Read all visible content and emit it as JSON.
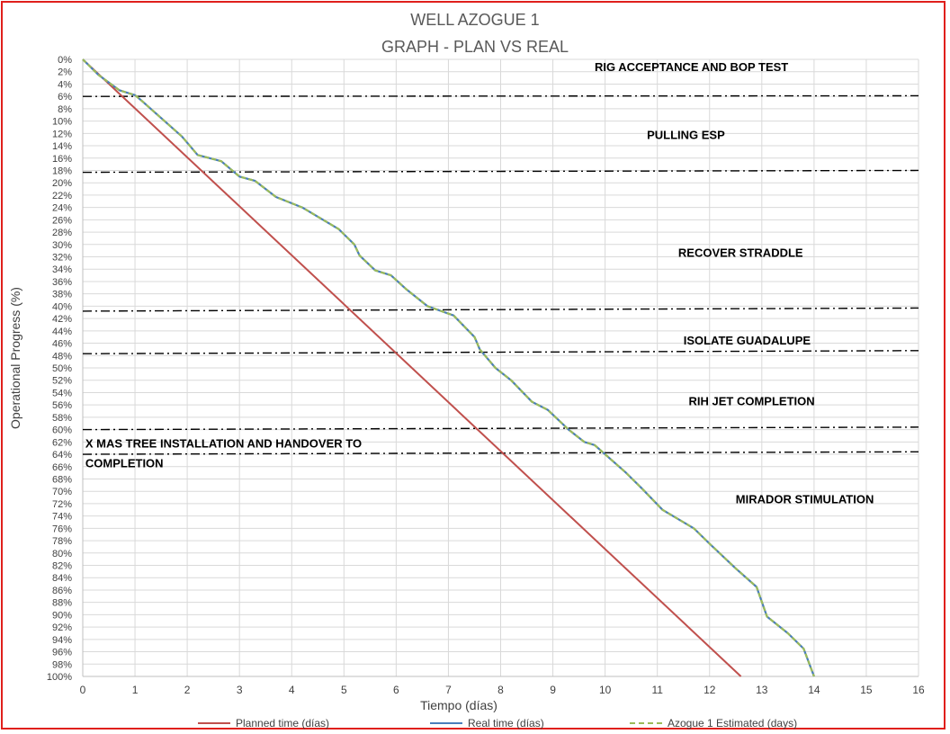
{
  "chart_data": {
    "type": "line",
    "title": [
      "WELL AZOGUE 1",
      "GRAPH  - PLAN VS REAL"
    ],
    "xlabel": "Tiempo (días)",
    "ylabel": "Operational Progress (%)",
    "xlim": [
      0,
      16
    ],
    "ylim": [
      0,
      100
    ],
    "y_inverted": true,
    "x_ticks": [
      0,
      1,
      2,
      3,
      4,
      5,
      6,
      7,
      8,
      9,
      10,
      11,
      12,
      13,
      14,
      15,
      16
    ],
    "y_ticks": [
      "0%",
      "2%",
      "4%",
      "6%",
      "8%",
      "10%",
      "12%",
      "14%",
      "16%",
      "18%",
      "20%",
      "22%",
      "24%",
      "26%",
      "28%",
      "30%",
      "32%",
      "34%",
      "36%",
      "38%",
      "40%",
      "42%",
      "44%",
      "46%",
      "48%",
      "50%",
      "52%",
      "54%",
      "56%",
      "58%",
      "60%",
      "62%",
      "64%",
      "66%",
      "68%",
      "70%",
      "72%",
      "74%",
      "76%",
      "78%",
      "80%",
      "82%",
      "84%",
      "86%",
      "88%",
      "90%",
      "92%",
      "94%",
      "96%",
      "98%",
      "100%"
    ],
    "grid": true,
    "legend_position": "bottom",
    "series": [
      {
        "name": "Planned time (días)",
        "color": "#c0504d",
        "style": "solid",
        "points": [
          [
            0,
            0
          ],
          [
            12.6,
            100
          ]
        ]
      },
      {
        "name": "Real time (días)",
        "color": "#4a7ebb",
        "style": "solid",
        "points": [
          [
            0,
            0
          ],
          [
            0.3,
            2.5
          ],
          [
            0.7,
            5
          ],
          [
            1.0,
            5.8
          ],
          [
            1.1,
            6.5
          ],
          [
            1.5,
            9.5
          ],
          [
            1.9,
            12.5
          ],
          [
            2.2,
            15.5
          ],
          [
            2.65,
            16.5
          ],
          [
            3.0,
            19
          ],
          [
            3.3,
            19.7
          ],
          [
            3.7,
            22.3
          ],
          [
            4.2,
            24
          ],
          [
            4.5,
            25.5
          ],
          [
            4.9,
            27.5
          ],
          [
            5.2,
            30
          ],
          [
            5.3,
            31.8
          ],
          [
            5.6,
            34.2
          ],
          [
            5.9,
            35
          ],
          [
            6.2,
            37.3
          ],
          [
            6.6,
            40
          ],
          [
            7.1,
            41.5
          ],
          [
            7.5,
            45
          ],
          [
            7.6,
            47
          ],
          [
            7.9,
            50
          ],
          [
            8.2,
            52
          ],
          [
            8.6,
            55.5
          ],
          [
            8.9,
            56.8
          ],
          [
            9.3,
            60
          ],
          [
            9.6,
            62
          ],
          [
            9.8,
            62.5
          ],
          [
            10.4,
            67
          ],
          [
            10.7,
            69.5
          ],
          [
            11.1,
            73
          ],
          [
            11.7,
            76
          ],
          [
            12.0,
            78.5
          ],
          [
            12.5,
            82.5
          ],
          [
            12.9,
            85.5
          ],
          [
            13.1,
            90.3
          ],
          [
            13.5,
            93
          ],
          [
            13.8,
            95.5
          ],
          [
            14.0,
            100
          ]
        ]
      },
      {
        "name": "Azogue 1 Estimated (days)",
        "color": "#9bbb59",
        "style": "dashed",
        "points": [
          [
            0,
            0
          ],
          [
            0.3,
            2.5
          ],
          [
            0.7,
            5
          ],
          [
            1.0,
            5.8
          ],
          [
            1.1,
            6.5
          ],
          [
            1.5,
            9.5
          ],
          [
            1.9,
            12.5
          ],
          [
            2.2,
            15.5
          ],
          [
            2.65,
            16.5
          ],
          [
            3.0,
            19
          ],
          [
            3.3,
            19.7
          ],
          [
            3.7,
            22.3
          ],
          [
            4.2,
            24
          ],
          [
            4.5,
            25.5
          ],
          [
            4.9,
            27.5
          ],
          [
            5.2,
            30
          ],
          [
            5.3,
            31.8
          ],
          [
            5.6,
            34.2
          ],
          [
            5.9,
            35
          ],
          [
            6.2,
            37.3
          ],
          [
            6.6,
            40
          ],
          [
            7.1,
            41.5
          ],
          [
            7.5,
            45
          ],
          [
            7.6,
            47
          ],
          [
            7.9,
            50
          ],
          [
            8.2,
            52
          ],
          [
            8.6,
            55.5
          ],
          [
            8.9,
            56.8
          ],
          [
            9.3,
            60
          ],
          [
            9.6,
            62
          ],
          [
            9.8,
            62.5
          ],
          [
            10.4,
            67
          ],
          [
            10.7,
            69.5
          ],
          [
            11.1,
            73
          ],
          [
            11.7,
            76
          ],
          [
            12.0,
            78.5
          ],
          [
            12.5,
            82.5
          ],
          [
            12.9,
            85.5
          ],
          [
            13.1,
            90.3
          ],
          [
            13.5,
            93
          ],
          [
            13.8,
            95.5
          ],
          [
            14.0,
            100
          ]
        ]
      }
    ],
    "phase_lines": [
      {
        "y_start": 6,
        "y_end": 5.9
      },
      {
        "y_start": 18.3,
        "y_end": 18.0
      },
      {
        "y_start": 40.8,
        "y_end": 40.3
      },
      {
        "y_start": 47.7,
        "y_end": 47.2
      },
      {
        "y_start": 60.0,
        "y_end": 59.6
      },
      {
        "y_start": 64.0,
        "y_end": 63.6
      }
    ],
    "annotations": [
      {
        "text": "RIG ACCEPTANCE AND BOP TEST",
        "x": 9.8,
        "y": 1.2
      },
      {
        "text": "PULLING ESP",
        "x": 10.8,
        "y": 12.2
      },
      {
        "text": "RECOVER STRADDLE",
        "x": 11.4,
        "y": 31.3
      },
      {
        "text": "ISOLATE GUADALUPE",
        "x": 11.5,
        "y": 45.5
      },
      {
        "text": "RIH JET COMPLETION",
        "x": 11.6,
        "y": 55.3
      },
      {
        "text": "X MAS TREE INSTALLATION AND HANDOVER TO",
        "x": 0.05,
        "y": 62.2
      },
      {
        "text": "COMPLETION",
        "x": 0.05,
        "y": 65.4
      },
      {
        "text": "MIRADOR STIMULATION",
        "x": 12.5,
        "y": 71.2
      }
    ]
  }
}
